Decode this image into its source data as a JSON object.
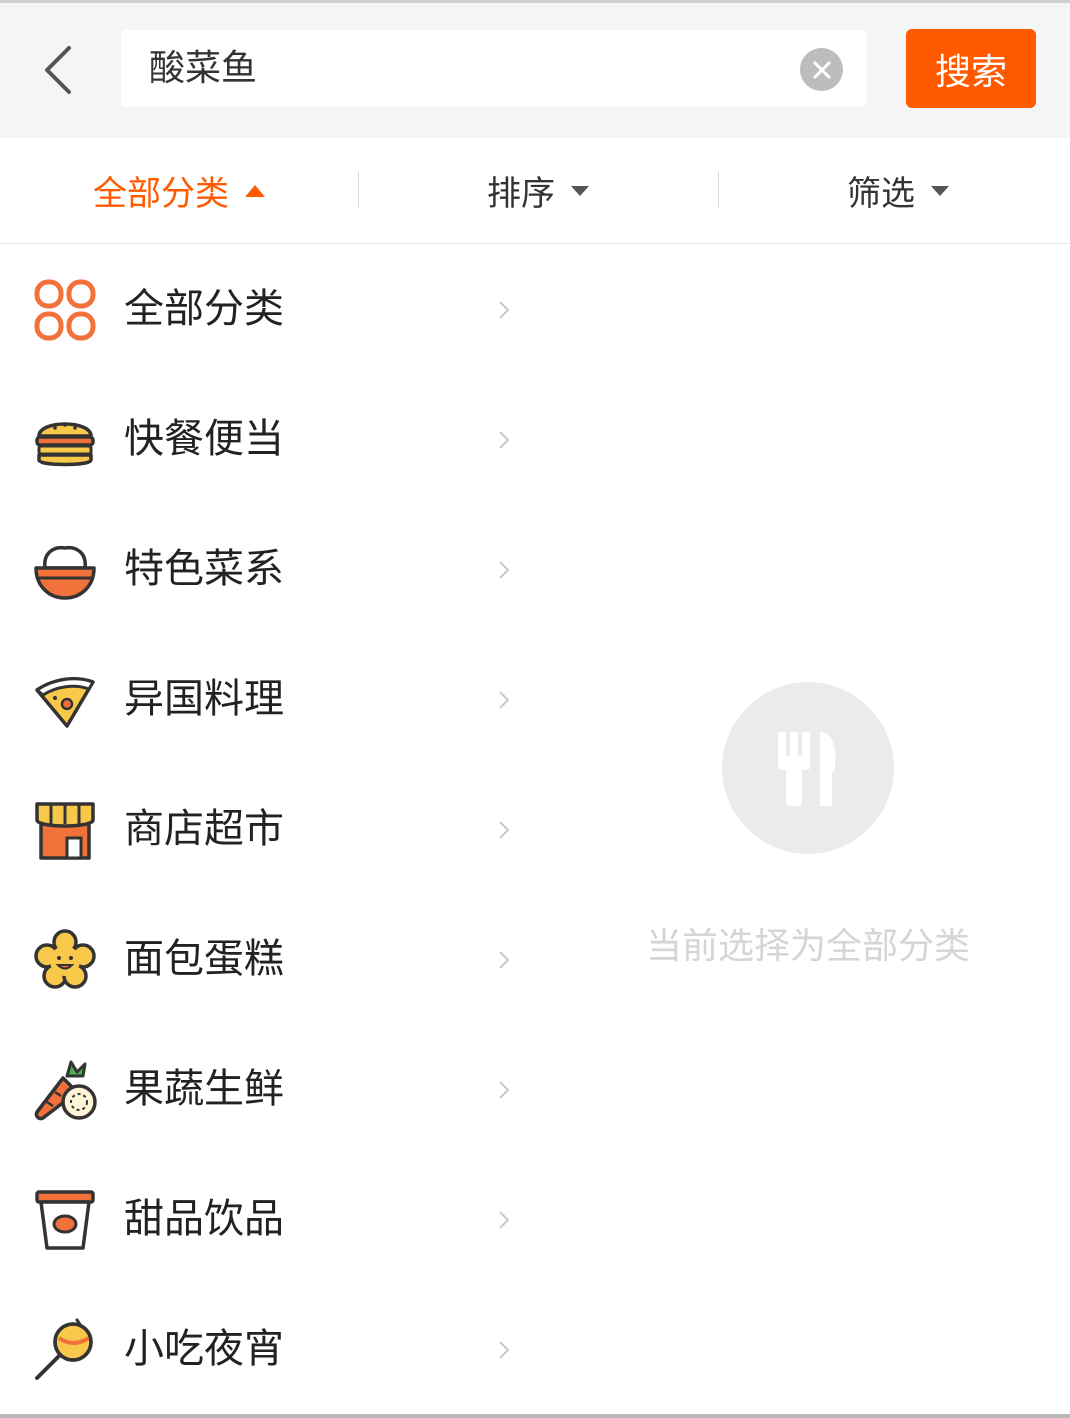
{
  "search": {
    "value": "酸菜鱼",
    "button_label": "搜索"
  },
  "filters": {
    "tabs": [
      {
        "label": "全部分类",
        "active": true
      },
      {
        "label": "排序",
        "active": false
      },
      {
        "label": "筛选",
        "active": false
      }
    ]
  },
  "categories": {
    "items": [
      {
        "label": "全部分类",
        "icon": "grid-icon"
      },
      {
        "label": "快餐便当",
        "icon": "burger-icon"
      },
      {
        "label": "特色菜系",
        "icon": "rice-bowl-icon"
      },
      {
        "label": "异国料理",
        "icon": "pizza-slice-icon"
      },
      {
        "label": "商店超市",
        "icon": "store-icon"
      },
      {
        "label": "面包蛋糕",
        "icon": "bread-icon"
      },
      {
        "label": "果蔬生鲜",
        "icon": "carrot-icon"
      },
      {
        "label": "甜品饮品",
        "icon": "drink-cup-icon"
      },
      {
        "label": "小吃夜宵",
        "icon": "skewer-icon"
      }
    ]
  },
  "empty_state": {
    "icon": "fork-knife-icon",
    "message": "当前选择为全部分类"
  },
  "colors": {
    "accent": "#ff5a00",
    "icon_orange": "#f2703a",
    "icon_yellow": "#f8c84a",
    "icon_dark": "#333333",
    "header_bg": "#f5f5f5",
    "muted_text": "#d5d5d5"
  }
}
